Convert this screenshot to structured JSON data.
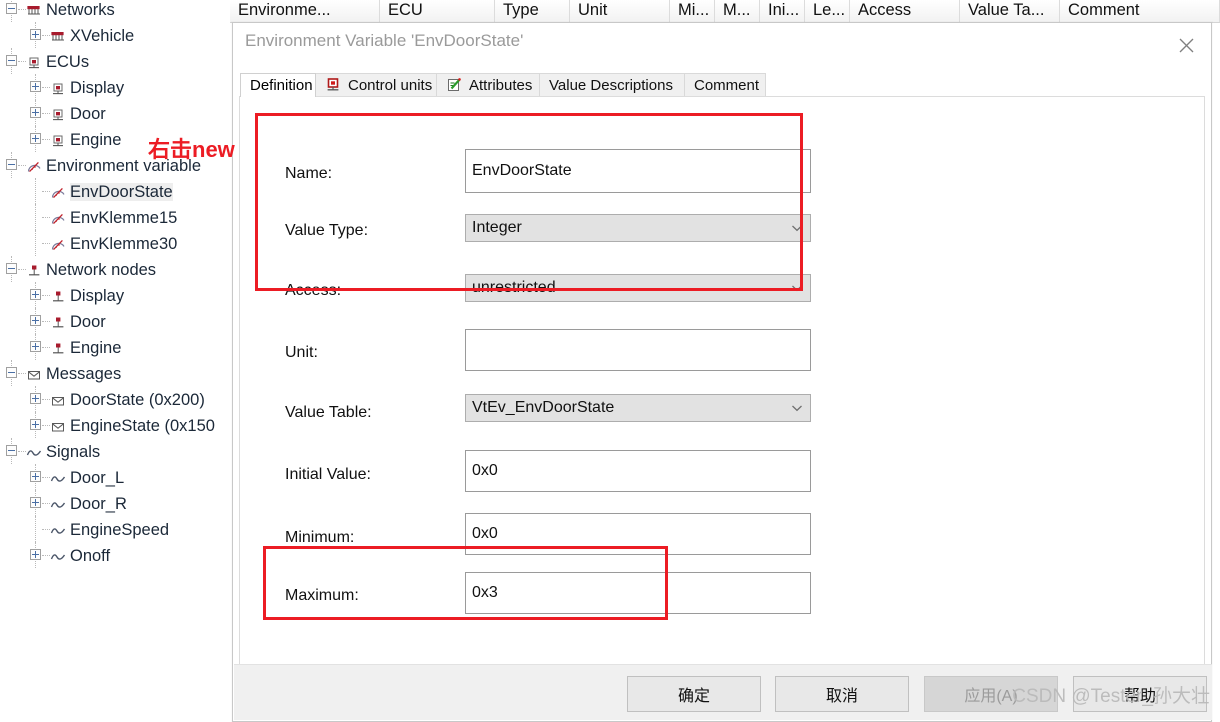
{
  "tree": {
    "items": [
      {
        "label": "Networks",
        "depth": 0,
        "icon": "network-icon",
        "expander": "minus",
        "selected": false
      },
      {
        "label": "XVehicle",
        "depth": 1,
        "icon": "network-icon",
        "expander": "plus",
        "selected": false
      },
      {
        "label": "ECUs",
        "depth": 0,
        "icon": "ecu-icon",
        "expander": "minus",
        "selected": false
      },
      {
        "label": "Display",
        "depth": 1,
        "icon": "ecu-icon",
        "expander": "plus",
        "selected": false
      },
      {
        "label": "Door",
        "depth": 1,
        "icon": "ecu-icon",
        "expander": "plus",
        "selected": false
      },
      {
        "label": "Engine",
        "depth": 1,
        "icon": "ecu-icon",
        "expander": "plus",
        "selected": false
      },
      {
        "label": "Environment variable",
        "depth": 0,
        "icon": "envvar-icon",
        "expander": "minus",
        "selected": false
      },
      {
        "label": "EnvDoorState",
        "depth": 1,
        "icon": "envvar-icon",
        "expander": "none",
        "selected": true
      },
      {
        "label": "EnvKlemme15",
        "depth": 1,
        "icon": "envvar-icon",
        "expander": "none",
        "selected": false
      },
      {
        "label": "EnvKlemme30",
        "depth": 1,
        "icon": "envvar-icon",
        "expander": "none",
        "selected": false
      },
      {
        "label": "Network nodes",
        "depth": 0,
        "icon": "node-icon",
        "expander": "minus",
        "selected": false
      },
      {
        "label": "Display",
        "depth": 1,
        "icon": "node-icon",
        "expander": "plus",
        "selected": false
      },
      {
        "label": "Door",
        "depth": 1,
        "icon": "node-icon",
        "expander": "plus",
        "selected": false
      },
      {
        "label": "Engine",
        "depth": 1,
        "icon": "node-icon",
        "expander": "plus",
        "selected": false
      },
      {
        "label": "Messages",
        "depth": 0,
        "icon": "message-icon",
        "expander": "minus",
        "selected": false
      },
      {
        "label": "DoorState (0x200)",
        "depth": 1,
        "icon": "message-icon",
        "expander": "plus",
        "selected": false
      },
      {
        "label": "EngineState (0x150",
        "depth": 1,
        "icon": "message-icon",
        "expander": "plus",
        "selected": false
      },
      {
        "label": "Signals",
        "depth": 0,
        "icon": "signal-icon",
        "expander": "minus",
        "selected": false
      },
      {
        "label": "Door_L",
        "depth": 1,
        "icon": "signal-icon",
        "expander": "plus",
        "selected": false
      },
      {
        "label": "Door_R",
        "depth": 1,
        "icon": "signal-icon",
        "expander": "plus",
        "selected": false
      },
      {
        "label": "EngineSpeed",
        "depth": 1,
        "icon": "signal-icon",
        "expander": "none",
        "selected": false
      },
      {
        "label": "Onoff",
        "depth": 1,
        "icon": "signal-icon",
        "expander": "plus",
        "selected": false
      }
    ]
  },
  "columns": [
    {
      "label": "Environme...",
      "width": 150
    },
    {
      "label": "ECU",
      "width": 115
    },
    {
      "label": "Type",
      "width": 75
    },
    {
      "label": "Unit",
      "width": 100
    },
    {
      "label": "Mi...",
      "width": 45
    },
    {
      "label": "M...",
      "width": 45
    },
    {
      "label": "Ini...",
      "width": 45
    },
    {
      "label": "Le...",
      "width": 45
    },
    {
      "label": "Access",
      "width": 110
    },
    {
      "label": "Value Ta...",
      "width": 100
    },
    {
      "label": "Comment",
      "width": 160
    }
  ],
  "dialog": {
    "title": "Environment Variable 'EnvDoorState'",
    "close_label": "×",
    "tabs": [
      {
        "label": "Definition",
        "icon": null,
        "active": true
      },
      {
        "label": "Control units",
        "icon": "control-unit-icon",
        "active": false
      },
      {
        "label": "Attributes",
        "icon": "attributes-icon",
        "active": false
      },
      {
        "label": "Value Descriptions",
        "icon": null,
        "active": false
      },
      {
        "label": "Comment",
        "icon": null,
        "active": false
      }
    ],
    "fields": [
      {
        "label": "Name:",
        "value": "EnvDoorState",
        "kind": "text"
      },
      {
        "label": "Value Type:",
        "value": "Integer",
        "kind": "select"
      },
      {
        "label": "Access:",
        "value": "unrestricted",
        "kind": "select"
      },
      {
        "label": "Unit:",
        "value": "",
        "kind": "text"
      },
      {
        "label": "Value Table:",
        "value": "VtEv_EnvDoorState",
        "kind": "select"
      },
      {
        "label": "Initial Value:",
        "value": "0x0",
        "kind": "text"
      },
      {
        "label": "Minimum:",
        "value": "0x0",
        "kind": "text"
      },
      {
        "label": "Maximum:",
        "value": "0x3",
        "kind": "text"
      }
    ],
    "buttons": [
      {
        "label": "确定",
        "disabled": false
      },
      {
        "label": "取消",
        "disabled": false
      },
      {
        "label": "应用(A)",
        "disabled": true
      },
      {
        "label": "帮助",
        "disabled": false
      }
    ]
  },
  "annotations": {
    "red_note": "右击new",
    "red_color": "#ec1c24"
  },
  "watermark": "CSDN @Tester_孙大壮"
}
